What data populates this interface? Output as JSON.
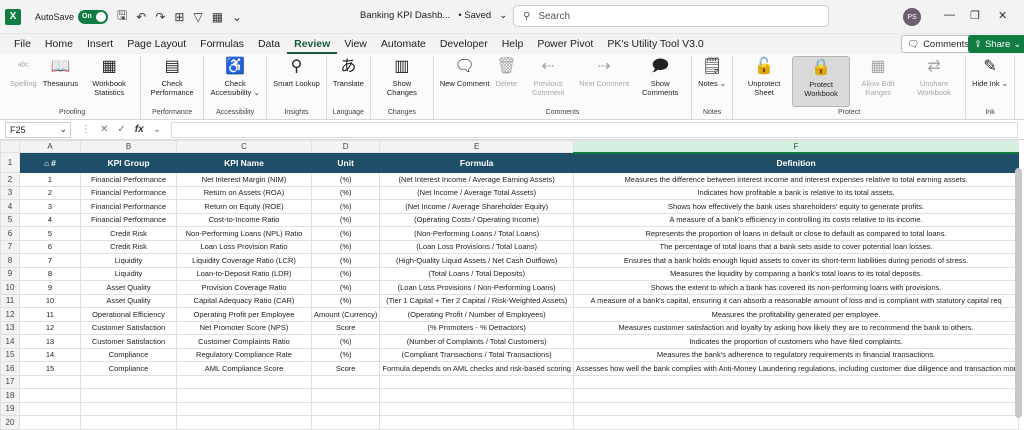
{
  "titlebar": {
    "autosave": "AutoSave",
    "toggle": "On",
    "doc_title": "Banking KPI Dashb...",
    "saved": "• Saved",
    "search_placeholder": "Search",
    "avatar": "PS"
  },
  "menu": [
    "File",
    "Home",
    "Insert",
    "Page Layout",
    "Formulas",
    "Data",
    "Review",
    "View",
    "Automate",
    "Developer",
    "Help",
    "Power Pivot",
    "PK's Utility Tool V3.0"
  ],
  "menu_active": "Review",
  "comments_label": "Comments",
  "share_label": "Share",
  "ribbon": {
    "groups": [
      {
        "label": "Proofing",
        "buttons": [
          {
            "label": "Spelling",
            "icon": "abc",
            "disabled": true
          },
          {
            "label": "Thesaurus",
            "icon": "book-icon"
          },
          {
            "label": "Workbook Statistics",
            "icon": "stats-icon"
          }
        ]
      },
      {
        "label": "Performance",
        "buttons": [
          {
            "label": "Check Performance",
            "icon": "grid-check-icon"
          }
        ]
      },
      {
        "label": "Accessibility",
        "buttons": [
          {
            "label": "Check Accessibility ⌄",
            "icon": "accessibility-icon"
          }
        ]
      },
      {
        "label": "Insights",
        "buttons": [
          {
            "label": "Smart Lookup",
            "icon": "search-icon"
          }
        ]
      },
      {
        "label": "Language",
        "buttons": [
          {
            "label": "Translate",
            "icon": "translate-icon"
          }
        ]
      },
      {
        "label": "Changes",
        "buttons": [
          {
            "label": "Show Changes",
            "icon": "changes-icon"
          }
        ]
      },
      {
        "label": "Comments",
        "buttons": [
          {
            "label": "New Comment",
            "icon": "new-comment-icon"
          },
          {
            "label": "Delete",
            "icon": "delete-icon",
            "disabled": true
          },
          {
            "label": "Previous Comment",
            "icon": "prev-icon",
            "disabled": true
          },
          {
            "label": "Next Comment",
            "icon": "next-icon",
            "disabled": true
          },
          {
            "label": "Show Comments",
            "icon": "comments-icon"
          }
        ]
      },
      {
        "label": "Notes",
        "buttons": [
          {
            "label": "Notes ⌄",
            "icon": "notes-icon"
          }
        ]
      },
      {
        "label": "Protect",
        "buttons": [
          {
            "label": "Unprotect Sheet",
            "icon": "unprotect-icon"
          },
          {
            "label": "Protect Workbook",
            "icon": "protect-icon",
            "selected": true
          },
          {
            "label": "Allow Edit Ranges",
            "icon": "ranges-icon",
            "disabled": true
          },
          {
            "label": "Unshare Workbook",
            "icon": "unshare-icon",
            "disabled": true
          }
        ]
      },
      {
        "label": "Ink",
        "buttons": [
          {
            "label": "Hide Ink ⌄",
            "icon": "ink-icon"
          }
        ]
      }
    ]
  },
  "formula_bar": {
    "cell": "F25",
    "fx": "fx",
    "value": ""
  },
  "columns": [
    "A",
    "B",
    "C",
    "D",
    "E",
    "F"
  ],
  "selected_column": "F",
  "headers": [
    "#",
    "KPI Group",
    "KPI Name",
    "Unit",
    "Formula",
    "Definition"
  ],
  "rows": [
    [
      "1",
      "Financial Performance",
      "Net Interest Margin (NIM)",
      "(%)",
      "(Net Interest Income / Average Earning Assets)",
      "Measures the difference between interest income and interest expenses relative to total earning assets."
    ],
    [
      "2",
      "Financial Performance",
      "Return on Assets (ROA)",
      "(%)",
      "(Net Income / Average Total Assets)",
      "Indicates how profitable a bank is relative to its total assets."
    ],
    [
      "3",
      "Financial Performance",
      "Return on Equity (ROE)",
      "(%)",
      "(Net Income / Average Shareholder Equity)",
      "Shows how effectively the bank uses shareholders' equity to generate profits."
    ],
    [
      "4",
      "Financial Performance",
      "Cost-to-Income Ratio",
      "(%)",
      "(Operating Costs / Operating Income)",
      "A measure of a bank's efficiency in controlling its costs relative to its income."
    ],
    [
      "5",
      "Credit Risk",
      "Non-Performing Loans (NPL) Ratio",
      "(%)",
      "(Non-Performing Loans / Total Loans)",
      "Represents the proportion of loans in default or close to default as compared to total loans."
    ],
    [
      "6",
      "Credit Risk",
      "Loan Loss Provision Ratio",
      "(%)",
      "(Loan Loss Provisions / Total Loans)",
      "The percentage of total loans that a bank sets aside to cover potential loan losses."
    ],
    [
      "7",
      "Liquidity",
      "Liquidity Coverage Ratio (LCR)",
      "(%)",
      "(High-Quality Liquid Assets / Net Cash Outflows)",
      "Ensures that a bank holds enough liquid assets to cover its short-term liabilities during periods of stress."
    ],
    [
      "8",
      "Liquidity",
      "Loan-to-Deposit Ratio (LDR)",
      "(%)",
      "(Total Loans / Total Deposits)",
      "Measures the liquidity by comparing a bank's total loans to its total deposits."
    ],
    [
      "9",
      "Asset Quality",
      "Provision Coverage Ratio",
      "(%)",
      "(Loan Loss Provisions / Non-Performing Loans)",
      "Shows the extent to which a bank has covered its non-performing loans with provisions."
    ],
    [
      "10",
      "Asset Quality",
      "Capital Adequacy Ratio (CAR)",
      "(%)",
      "(Tier 1 Capital + Tier 2 Capital / Risk-Weighted Assets)",
      "A measure of a bank's capital, ensuring it can absorb a reasonable amount of loss and is compliant with statutory capital req"
    ],
    [
      "11",
      "Operational Efficiency",
      "Operating Profit per Employee",
      "Amount (Currency)",
      "(Operating Profit / Number of Employees)",
      "Measures the profitability generated per employee."
    ],
    [
      "12",
      "Customer Satisfaction",
      "Net Promoter Score (NPS)",
      "Score",
      "(% Promoters - % Detractors)",
      "Measures customer satisfaction and loyalty by asking how likely they are to recommend the bank to others."
    ],
    [
      "13",
      "Customer Satisfaction",
      "Customer Complaints Ratio",
      "(%)",
      "(Number of Complaints / Total Customers)",
      "Indicates the proportion of customers who have filed complaints."
    ],
    [
      "14",
      "Compliance",
      "Regulatory Compliance Rate",
      "(%)",
      "(Compliant Transactions / Total Transactions)",
      "Measures the bank's adherence to regulatory requirements in financial transactions."
    ],
    [
      "15",
      "Compliance",
      "AML Compliance Score",
      "Score",
      "Formula depends on AML checks and risk-based scoring",
      "Assesses how well the bank complies with Anti-Money Laundering regulations, including customer due diligence and transaction mor"
    ]
  ],
  "empty_rows": [
    "17",
    "18",
    "19",
    "20"
  ]
}
